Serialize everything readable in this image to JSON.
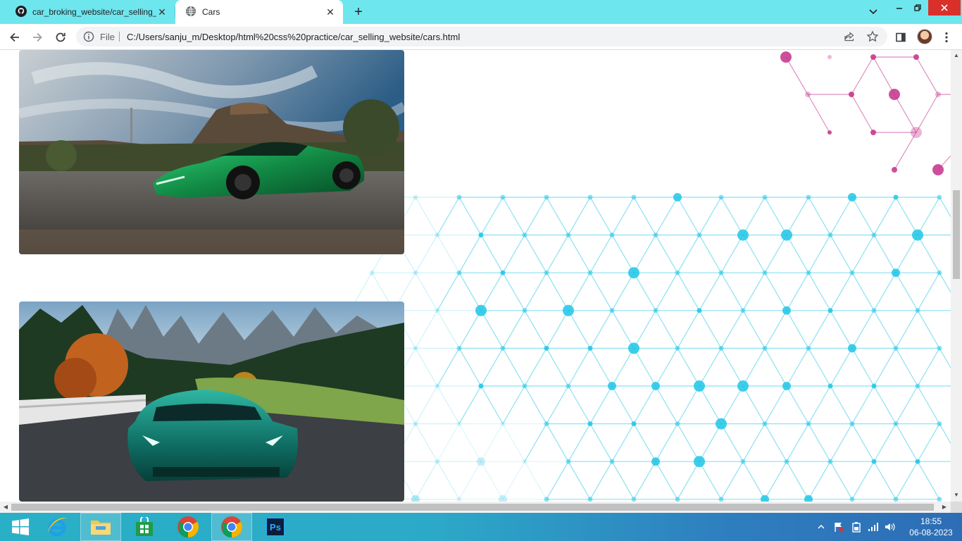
{
  "browser": {
    "tabs": [
      {
        "title": "car_broking_website/car_selling_w",
        "icon": "github-icon",
        "active": false
      },
      {
        "title": "Cars",
        "icon": "globe-icon",
        "active": true
      }
    ],
    "omnibox": {
      "scheme_label": "File",
      "url": "C:/Users/sanju_m/Desktop/html%20css%20practice/car_selling_website/cars.html"
    },
    "toolbar_icons": [
      "back-icon",
      "forward-icon",
      "reload-icon",
      "share-icon",
      "star-icon",
      "side-panel-icon",
      "profile-avatar",
      "menu-icon"
    ]
  },
  "page": {
    "cars": [
      {
        "description": "green sports car parked on a desert road"
      },
      {
        "description": "teal sports car driving on a mountain road"
      }
    ],
    "background": "hexagonal network pattern",
    "colors": {
      "pattern_blue": "#1ec5e6",
      "pattern_pink": "#c4308a"
    }
  },
  "taskbar": {
    "apps": [
      "start-icon",
      "internet-explorer-icon",
      "file-explorer-icon",
      "store-icon",
      "chrome-icon",
      "chrome-icon",
      "photoshop-icon"
    ],
    "photoshop_label": "Ps",
    "clock": {
      "time": "18:55",
      "date": "06-08-2023"
    }
  }
}
